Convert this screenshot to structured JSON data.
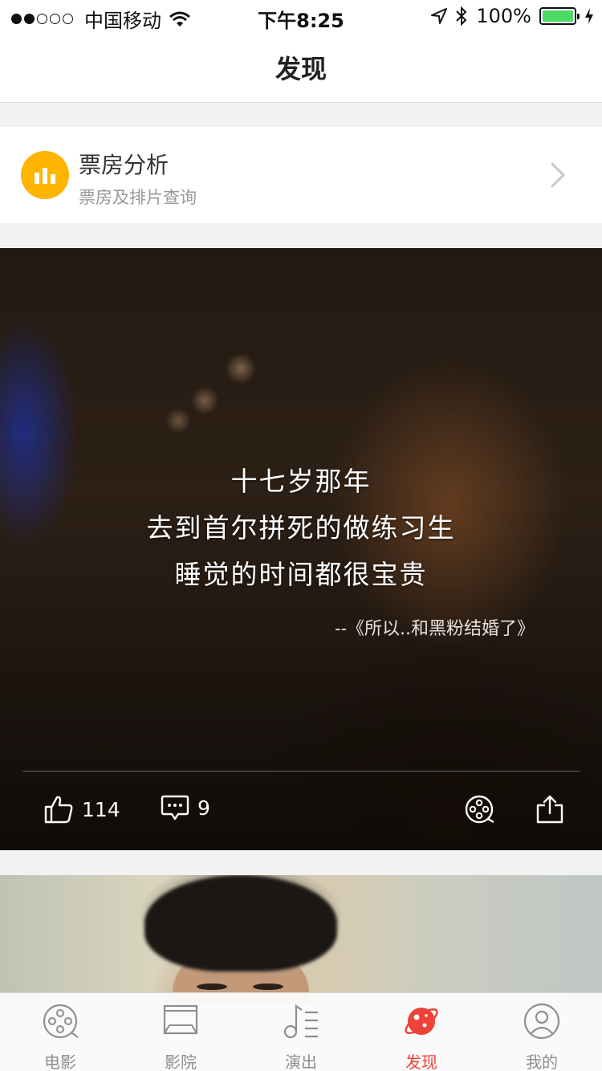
{
  "status_bar": {
    "carrier": "中国移动",
    "time": "下午8:25",
    "battery": "100%"
  },
  "nav": {
    "title": "发现"
  },
  "box_office": {
    "title": "票房分析",
    "subtitle": "票房及排片查询",
    "icon": "bar-chart-icon",
    "accent": "#ffb400"
  },
  "feed": [
    {
      "quote_lines": [
        "十七岁那年",
        "去到首尔拼死的做练习生",
        "睡觉的时间都很宝贵"
      ],
      "source": "--《所以..和黑粉结婚了》",
      "likes": "114",
      "comments": "9"
    }
  ],
  "tabs": [
    {
      "label": "电影",
      "icon": "film-reel-icon",
      "active": false
    },
    {
      "label": "影院",
      "icon": "cinema-screen-icon",
      "active": false
    },
    {
      "label": "演出",
      "icon": "music-note-icon",
      "active": false
    },
    {
      "label": "发现",
      "icon": "planet-icon",
      "active": true
    },
    {
      "label": "我的",
      "icon": "user-icon",
      "active": false
    }
  ],
  "colors": {
    "active_tab": "#ef4238",
    "inactive_tab": "#8e8e93"
  }
}
